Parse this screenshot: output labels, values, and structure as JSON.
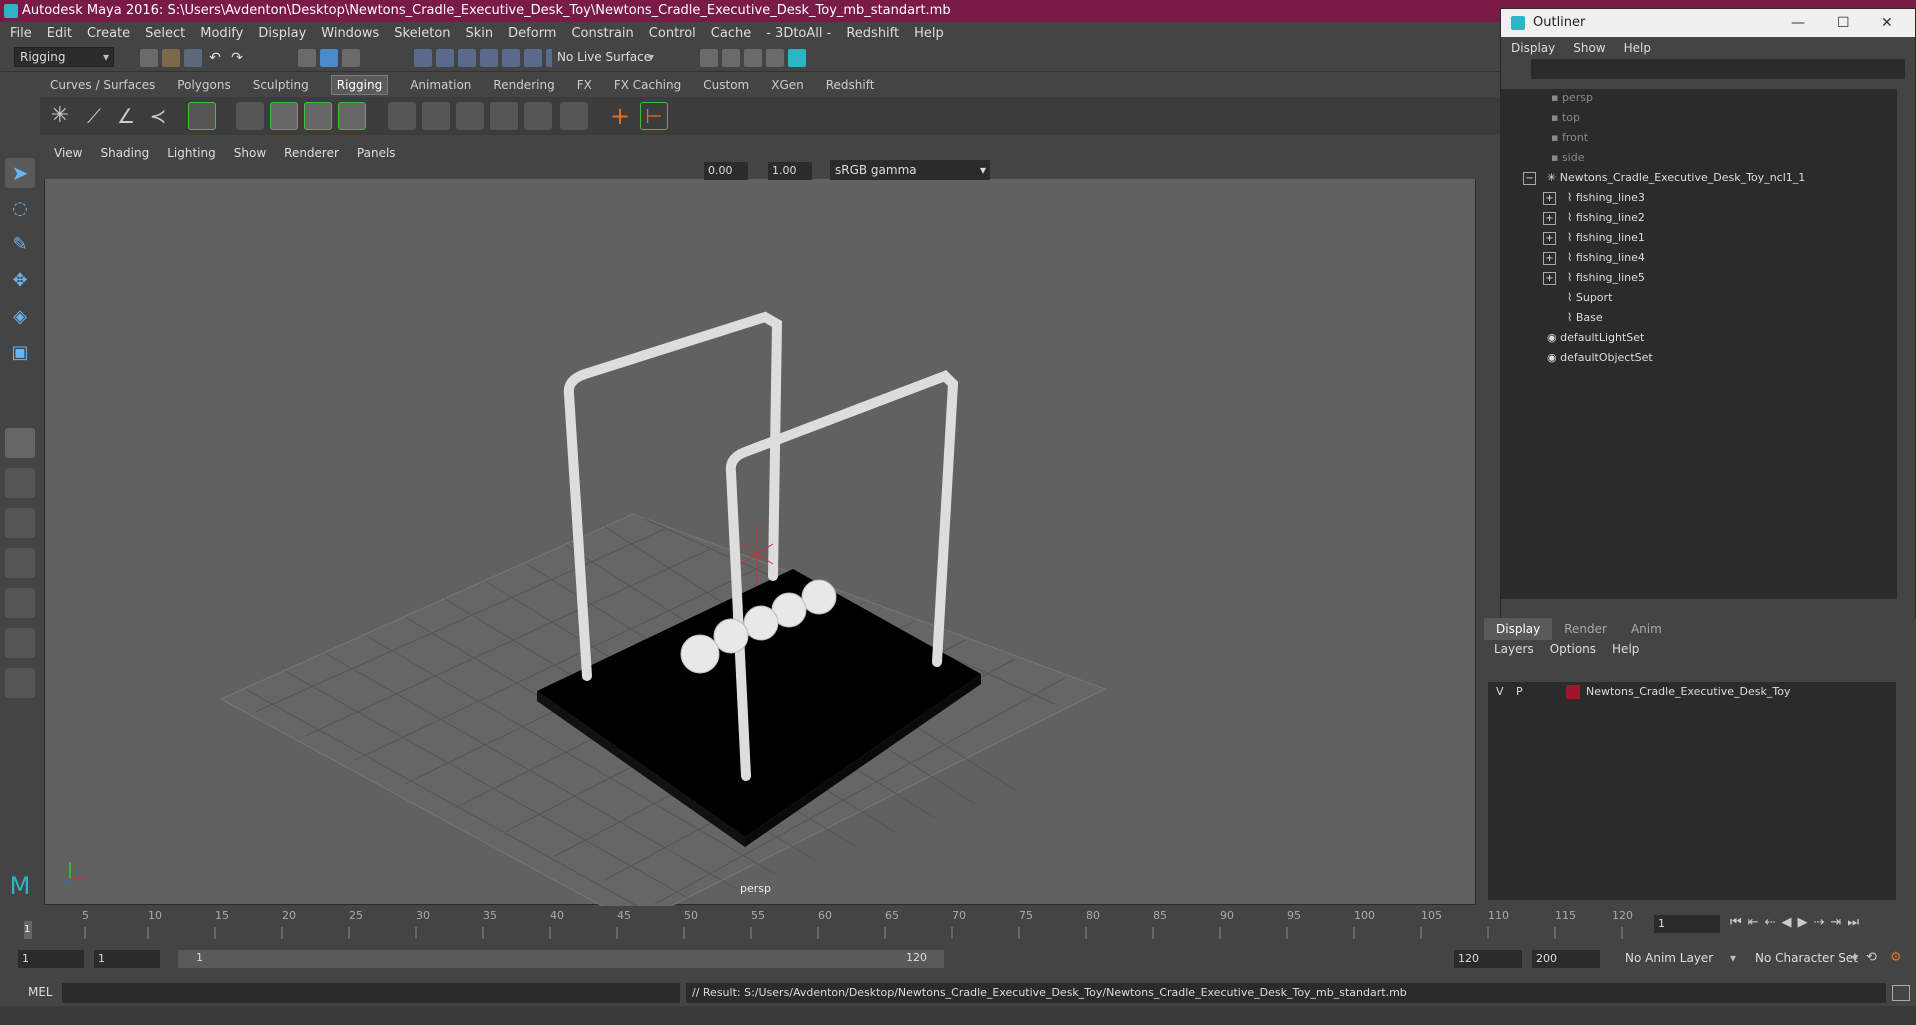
{
  "window": {
    "title": "Autodesk Maya 2016: S:\\Users\\Avdenton\\Desktop\\Newtons_Cradle_Executive_Desk_Toy\\Newtons_Cradle_Executive_Desk_Toy_mb_standart.mb"
  },
  "menubar": [
    "File",
    "Edit",
    "Create",
    "Select",
    "Modify",
    "Display",
    "Windows",
    "Skeleton",
    "Skin",
    "Deform",
    "Constrain",
    "Control",
    "Cache",
    "- 3DtoAll -",
    "Redshift",
    "Help"
  ],
  "toolbar": {
    "mode": "Rigging",
    "live_surface": "No Live Surface"
  },
  "shelf_tabs": [
    "Curves / Surfaces",
    "Polygons",
    "Sculpting",
    "Rigging",
    "Animation",
    "Rendering",
    "FX",
    "FX Caching",
    "Custom",
    "XGen",
    "Redshift"
  ],
  "active_shelf": "Rigging",
  "viewport": {
    "menu": [
      "View",
      "Shading",
      "Lighting",
      "Show",
      "Renderer",
      "Panels"
    ],
    "exposure": "0.00",
    "gamma_value": "1.00",
    "colorspace": "sRGB gamma",
    "camera_label": "persp"
  },
  "outliner": {
    "title": "Outliner",
    "menu": [
      "Display",
      "Show",
      "Help"
    ],
    "cameras": [
      "persp",
      "top",
      "front",
      "side"
    ],
    "group": "Newtons_Cradle_Executive_Desk_Toy_ncl1_1",
    "children": [
      "fishing_line3",
      "fishing_line2",
      "fishing_line1",
      "fishing_line4",
      "fishing_line5",
      "Suport",
      "Base"
    ],
    "sets": [
      "defaultLightSet",
      "defaultObjectSet"
    ]
  },
  "layers": {
    "tabs": [
      "Display",
      "Render",
      "Anim"
    ],
    "menu": [
      "Layers",
      "Options",
      "Help"
    ],
    "layer_v": "V",
    "layer_p": "P",
    "layer_name": "Newtons_Cradle_Executive_Desk_Toy",
    "layer_color": "#a0142c"
  },
  "timeline": {
    "ticks": [
      "5",
      "10",
      "15",
      "20",
      "25",
      "30",
      "35",
      "40",
      "45",
      "50",
      "55",
      "60",
      "65",
      "70",
      "75",
      "80",
      "85",
      "90",
      "95",
      "100",
      "105",
      "110",
      "115",
      "120"
    ],
    "current_frame_marker": "1",
    "current_frame": "1"
  },
  "range": {
    "start": "1",
    "playback_start": "1",
    "slider_start": "1",
    "slider_end": "120",
    "playback_end": "120",
    "end": "200",
    "anim_layer": "No Anim Layer",
    "character_set": "No Character Set"
  },
  "command": {
    "mode": "MEL",
    "result": "// Result: S:/Users/Avdenton/Desktop/Newtons_Cradle_Executive_Desk_Toy/Newtons_Cradle_Executive_Desk_Toy_mb_standart.mb"
  },
  "colors": {
    "title_bar": "#7a1a47",
    "accent": "#2fb4c6",
    "active_tool": "#4a8ac8",
    "shelf_highlight": "#3fbf3f"
  }
}
